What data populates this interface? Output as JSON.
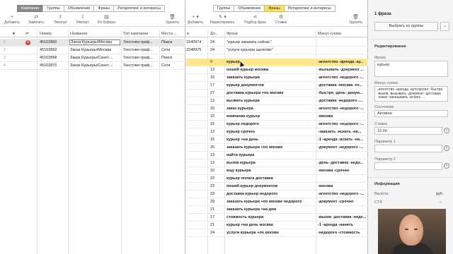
{
  "left_tabs": [
    {
      "label": "Кампании"
    },
    {
      "label": "Группы"
    },
    {
      "label": "Объявления"
    },
    {
      "label": "Фразы"
    },
    {
      "label": "Ретаргетинг и интересы"
    }
  ],
  "left_toolbar": [
    {
      "label": "Добавить",
      "icon": "plus-icon"
    },
    {
      "label": "Заменить",
      "icon": "replace-icon"
    },
    {
      "label": "Экспорт",
      "icon": "export-icon"
    },
    {
      "label": "Импорт",
      "icon": "import-icon"
    },
    {
      "label": "Из буфера",
      "icon": "clipboard-icon"
    },
    {
      "label": "Удалить",
      "icon": "trash-icon"
    }
  ],
  "left_columns": {
    "star": "★",
    "num": "Номер",
    "name": "Название",
    "type": "Тип кампании",
    "place": "Места ..."
  },
  "campaigns": [
    {
      "idx": "1",
      "num": "45102860",
      "name": "Заказ Курьеры\\Москва",
      "type": "Текстово-граф...",
      "place": "Поиск"
    },
    {
      "idx": "2",
      "num": "45102862",
      "name": "Заказ Курьеры\\Москва",
      "type": "Текстово-граф...",
      "place": "Сети"
    },
    {
      "idx": "3",
      "num": "45102868",
      "name": "Заказ Курьеры\\Санкт-...",
      "type": "Текстово-граф...",
      "place": "Поиск"
    },
    {
      "idx": "4",
      "num": "45102870",
      "name": "Заказ Курьеры\\Санкт-...",
      "type": "Текстово-граф...",
      "place": "Сети"
    }
  ],
  "mid_tabs": [
    {
      "label": "Группы"
    },
    {
      "label": "Объявления"
    },
    {
      "label": "Фразы"
    },
    {
      "label": "Ретаргетинг и интересы"
    }
  ],
  "mid_toolbar": [
    {
      "label": "Добавить",
      "icon": "plus-icon"
    },
    {
      "label": "Редактировать",
      "icon": "edit-icon"
    },
    {
      "label": "Подбор фраз",
      "icon": "share-icon"
    },
    {
      "label": "Ставки",
      "icon": "gear-icon"
    },
    {
      "label": "Удалить",
      "icon": "trash-icon"
    }
  ],
  "mid_columns": {
    "b": "в",
    "len": "Дл...",
    "phrase": "Фраза",
    "minus": "Минус-слова"
  },
  "top_rows": [
    {
      "id": "1540974",
      "len": "24",
      "phrase": "\"курьер заказать сейчас\"",
      "minus": ""
    },
    {
      "id": "1540975",
      "len": "24",
      "phrase": "\"услуги курьера щелково\"",
      "minus": ""
    }
  ],
  "phrases": [
    {
      "len": "6",
      "phrase": "курьер",
      "minus": "-агентство -аренда -ау..."
    },
    {
      "len": "13",
      "phrase": "пеший курьер москва",
      "minus": "-вызывать -документ ..."
    },
    {
      "len": "15",
      "phrase": "заказать курьера",
      "minus": "-агентство -недорого -..."
    },
    {
      "len": "17",
      "phrase": "курьер документов",
      "minus": "-доставка -москва -от..."
    },
    {
      "len": "27",
      "phrase": "доставка курьера +по москве",
      "minus": "-быстро -день -докум..."
    },
    {
      "len": "13",
      "phrase": "вызвать курьера",
      "minus": "-доставка -недорого -..."
    },
    {
      "len": "15",
      "phrase": "заказ курьера",
      "minus": "-агентство -недорого -..."
    },
    {
      "len": "15",
      "phrase": "компании курьер",
      "minus": "-москва"
    },
    {
      "len": "15",
      "phrase": "курьер недорого",
      "minus": "-агентство -недорого -..."
    },
    {
      "len": "13",
      "phrase": "курьер срочно",
      "minus": "-заказать -искать -на..."
    },
    {
      "len": "15",
      "phrase": "курьер +на день",
      "minus": "-1 -аренда -искать -на..."
    },
    {
      "len": "25",
      "phrase": "заказать курьера +по москве",
      "minus": "-документ -недорого -..."
    },
    {
      "len": "13",
      "phrase": "найти курьера",
      "minus": ""
    },
    {
      "len": "13",
      "phrase": "вызов курьера",
      "minus": "-день -доставка -недо..."
    },
    {
      "len": "10",
      "phrase": "ищу курьера",
      "minus": "-москва -срочно"
    },
    {
      "len": "22",
      "phrase": "курьер оплата доставка",
      "minus": ""
    },
    {
      "len": "23",
      "phrase": "пеший курьер документов",
      "minus": "-москва"
    },
    {
      "len": "23",
      "phrase": "доставка курьер недорого",
      "minus": "-агентство -недорого -..."
    },
    {
      "len": "29",
      "phrase": "заказать курьера +по москве недорого",
      "minus": "-документ -срочно"
    },
    {
      "len": "21",
      "phrase": "заказать курьера +на дом",
      "minus": ""
    },
    {
      "len": "17",
      "phrase": "стоимость курьера",
      "minus": "-вызов -доставка -неде..."
    },
    {
      "len": "21",
      "phrase": "курьер +на день москва",
      "minus": "-1 -аренда -нанять"
    },
    {
      "len": "24",
      "phrase": "услуги курьера +по москве",
      "minus": "-недорого -стоимость"
    }
  ],
  "right": {
    "title": "1 фраза",
    "choose_group": "Выбрать из группы",
    "section_edit": "Редактирование",
    "phrase_label": "Фраза",
    "phrase_value": "курьер",
    "minus_label": "Минус-слова",
    "minus_value": "-агентство -аренда -аутсорсинг -быстро -вызов -вызывать -документ -доставка -заказ -заказывать -искать ...",
    "state_label": "Состояние",
    "state_value": "Активна",
    "bid_label": "Ставка",
    "bid_value": "10.00",
    "param1_label": "Параметр 1",
    "param2_label": "Параметр 2",
    "section_info": "Информация",
    "currency_label": "Валюта",
    "currency_value": "руб.",
    "ctr_label": "CTR",
    "ctr_value": "–"
  }
}
